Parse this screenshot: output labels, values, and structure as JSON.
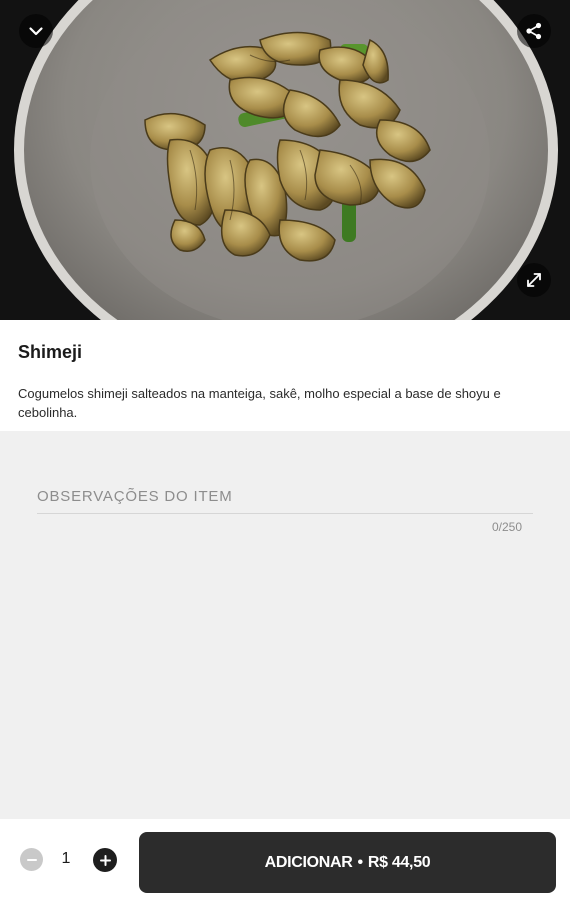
{
  "hero": {
    "collapse_icon": "chevron-down-icon",
    "share_icon": "share-icon",
    "expand_icon": "expand-icon"
  },
  "product": {
    "name": "Shimeji",
    "description": "Cogumelos shimeji salteados na manteiga, sakê, molho especial a base de shoyu e cebolinha."
  },
  "notes": {
    "placeholder": "OBSERVAÇÕES DO ITEM",
    "value": "",
    "counter": "0/250"
  },
  "order": {
    "quantity": "1",
    "minus_icon": "minus-circle-icon",
    "plus_icon": "plus-circle-icon",
    "add_label": "ADICIONAR",
    "separator": "•",
    "price": "R$ 44,50"
  },
  "colors": {
    "primary_button": "#2c2c2c",
    "notes_background": "#f0f0f0",
    "disabled_control": "#c9c9c9"
  }
}
